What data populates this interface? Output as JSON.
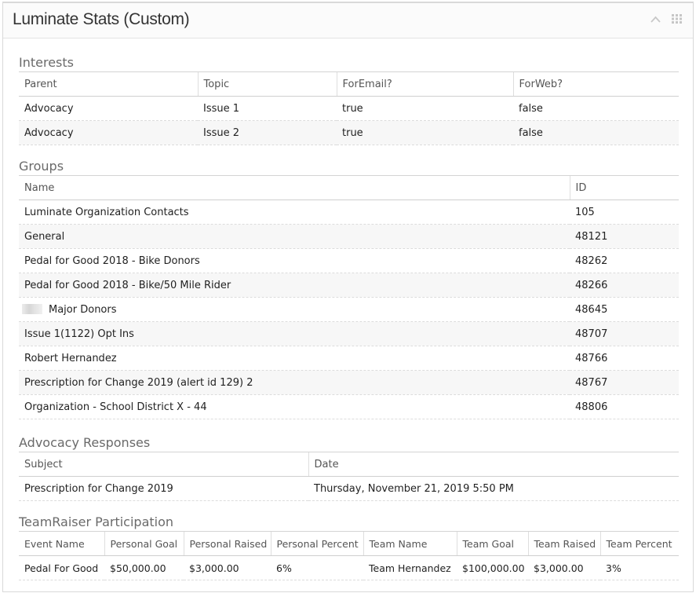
{
  "panel": {
    "title": "Luminate Stats (Custom)"
  },
  "icons": {
    "collapse": "chevron-up-icon",
    "menu": "grid-icon"
  },
  "interests": {
    "title": "Interests",
    "columns": [
      "Parent",
      "Topic",
      "ForEmail?",
      "ForWeb?"
    ],
    "rows": [
      [
        "Advocacy",
        "Issue 1",
        "true",
        "false"
      ],
      [
        "Advocacy",
        "Issue 2",
        "true",
        "false"
      ]
    ]
  },
  "groups": {
    "title": "Groups",
    "columns": [
      "Name",
      "ID"
    ],
    "rows": [
      [
        "Luminate Organization Contacts",
        "105"
      ],
      [
        "General",
        "48121"
      ],
      [
        "Pedal for Good 2018 - Bike Donors",
        "48262"
      ],
      [
        "Pedal for Good 2018 - Bike/50 Mile Rider",
        "48266"
      ],
      [
        "Major Donors",
        "48645"
      ],
      [
        "Issue 1(1122) Opt Ins",
        "48707"
      ],
      [
        "Robert Hernandez",
        "48766"
      ],
      [
        "Prescription for Change 2019 (alert id 129) 2",
        "48767"
      ],
      [
        "Organization - School District X - 44",
        "48806"
      ]
    ]
  },
  "advocacy": {
    "title": "Advocacy Responses",
    "columns": [
      "Subject",
      "Date"
    ],
    "rows": [
      [
        "Prescription for Change 2019",
        "Thursday, November 21, 2019 5:50 PM"
      ]
    ]
  },
  "teamraiser": {
    "title": "TeamRaiser Participation",
    "columns": [
      "Event Name",
      "Personal Goal",
      "Personal Raised",
      "Personal Percent",
      "Team Name",
      "Team Goal",
      "Team Raised",
      "Team Percent"
    ],
    "rows": [
      [
        "Pedal For Good",
        "$50,000.00",
        "$3,000.00",
        "6%",
        "Team Hernandez",
        "$100,000.00",
        "$3,000.00",
        "3%"
      ]
    ]
  }
}
